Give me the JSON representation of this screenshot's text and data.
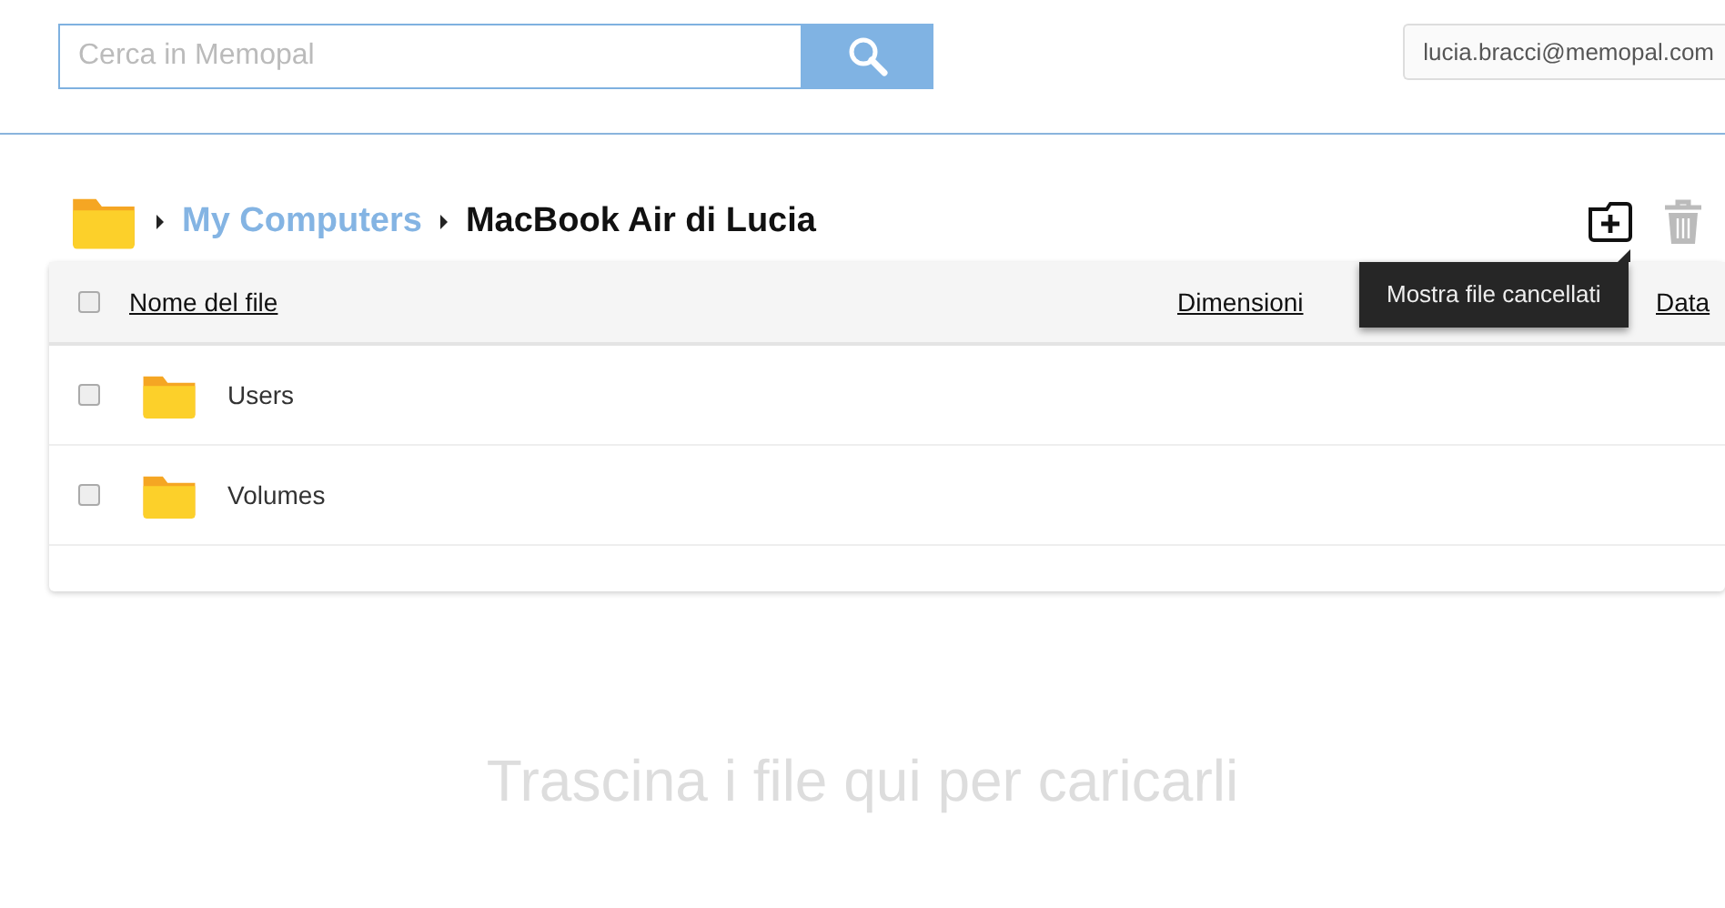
{
  "search": {
    "placeholder": "Cerca in Memopal"
  },
  "account": {
    "label": "lucia.bracci@memopal.com"
  },
  "breadcrumb": [
    {
      "label": "My Computers",
      "current": false
    },
    {
      "label": "MacBook Air di Lucia",
      "current": true
    }
  ],
  "toolbar": {
    "tooltip": "Mostra file cancellati"
  },
  "table": {
    "select_all": {
      "checked": false
    },
    "columns": [
      "Nome del file",
      "Dimensioni",
      "Data"
    ],
    "rows": [
      {
        "name": "Users",
        "checked": false
      },
      {
        "name": "Volumes",
        "checked": false
      }
    ]
  },
  "drop_hint": "Trascina i file qui per caricarli"
}
